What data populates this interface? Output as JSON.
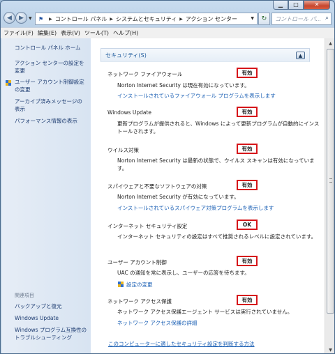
{
  "window": {
    "minimize_icon": "minimize-icon",
    "maximize_icon": "maximize-icon",
    "close_icon": "close-icon"
  },
  "nav": {
    "back_icon": "back-arrow-icon",
    "forward_icon": "forward-arrow-icon",
    "breadcrumbs": [
      "コントロール パネル",
      "システムとセキュリティ",
      "アクション センター"
    ],
    "search_placeholder": "コントロール パ..."
  },
  "menu": [
    "ファイル(F)",
    "編集(E)",
    "表示(V)",
    "ツール(T)",
    "ヘルプ(H)"
  ],
  "sidebar": {
    "home": "コントロール パネル ホーム",
    "links": [
      "アクション センターの設定を変更",
      "ユーザー アカウント制御設定の変更",
      "アーカイブ済みメッセージの表示",
      "パフォーマンス情報の表示"
    ],
    "related_title": "関連項目",
    "related": [
      "バックアップと復元",
      "Windows Update",
      "Windows プログラム互換性のトラブルシューティング"
    ]
  },
  "main": {
    "section_title": "セキュリティ(S)",
    "items": [
      {
        "title": "ネットワーク ファイアウォール",
        "status": "有効",
        "desc": "Norton Internet Security は現在有効になっています。",
        "link": "インストールされているファイアウォール プログラムを表示します"
      },
      {
        "title": "Windows Update",
        "status": "有効",
        "desc": "更新プログラムが提供されると、Windows によって更新プログラムが自動的にインストールされます。",
        "link": ""
      },
      {
        "title": "ウイルス対策",
        "status": "有効",
        "desc": "Norton Internet Security は最新の状態で、ウイルス スキャンは有効になっています。",
        "link": ""
      },
      {
        "title": "スパイウェアと不要なソフトウェアの対策",
        "status": "有効",
        "desc": "Norton Internet Security が有効になっています。",
        "link": "インストールされているスパイウェア対策プログラムを表示します"
      },
      {
        "title": "インターネット セキュリティ設定",
        "status": "OK",
        "desc": "インターネット セキュリティの設定はすべて推奨されるレベルに設定されています。",
        "link": ""
      },
      {
        "title": "ユーザー アカウント制御",
        "status": "有効",
        "desc": "UAC の通知を常に表示し、ユーザーの応答を待ちます。",
        "link": "設定の変更"
      },
      {
        "title": "ネットワーク アクセス保護",
        "status": "有効",
        "desc": "ネットワーク アクセス保護エージェント サービスは実行されていません。",
        "link": "ネットワーク アクセス保護の詳細"
      }
    ],
    "footer_link": "このコンピューターに適したセキュリティ設定を判断する方法"
  },
  "colors": {
    "badge_border": "#d6161a",
    "link": "#1a5fb4"
  }
}
